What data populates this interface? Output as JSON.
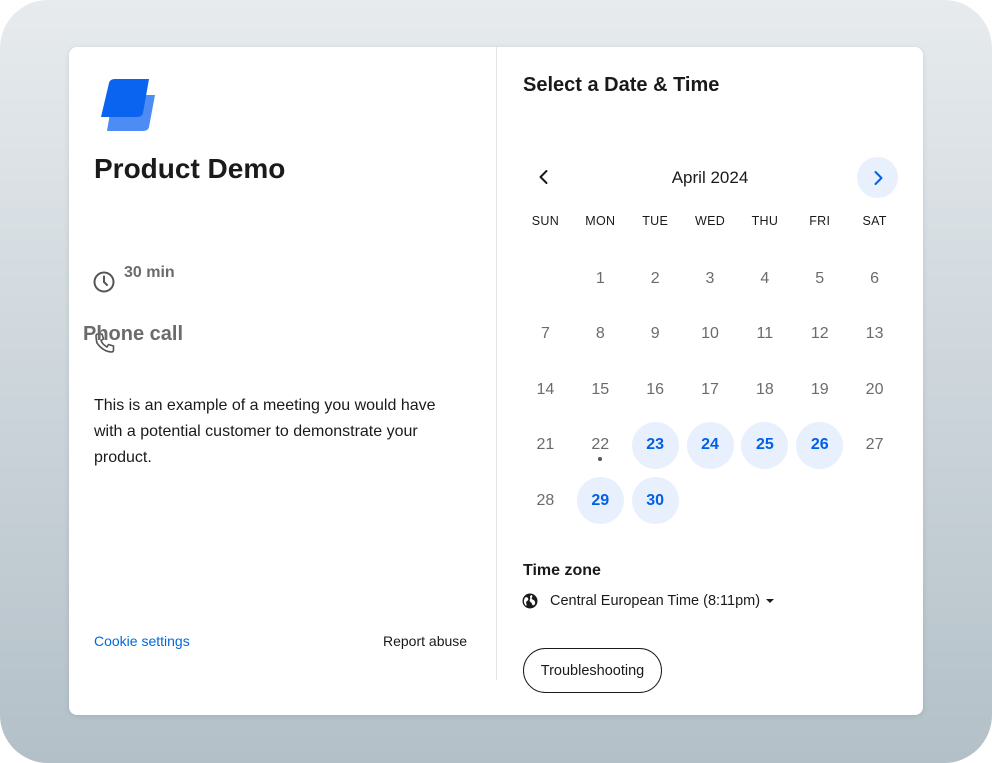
{
  "event": {
    "title": "Product Demo",
    "duration": "30 min",
    "location": "Phone call",
    "description": "This is an example of a meeting you would have with a potential customer to demonstrate your product."
  },
  "footer": {
    "cookie_settings": "Cookie settings",
    "report_abuse": "Report abuse"
  },
  "picker": {
    "title": "Select a Date & Time",
    "month": "April 2024",
    "weekdays": [
      "SUN",
      "MON",
      "TUE",
      "WED",
      "THU",
      "FRI",
      "SAT"
    ],
    "first_weekday_index": 1,
    "days_in_month": 30,
    "available_days": [
      23,
      24,
      25,
      26,
      29,
      30
    ],
    "today": 22
  },
  "timezone": {
    "label": "Time zone",
    "value": "Central European Time (8:11pm)"
  },
  "troubleshooting_label": "Troubleshooting",
  "colors": {
    "accent": "#0060e6",
    "available_bg": "#e8f0fd",
    "link": "#0069d9"
  },
  "icons": {
    "logo": "product-logo-icon",
    "duration": "clock-icon",
    "location": "phone-icon",
    "prev": "chevron-left-icon",
    "next": "chevron-right-icon",
    "timezone": "globe-icon",
    "dropdown": "caret-down-icon"
  }
}
